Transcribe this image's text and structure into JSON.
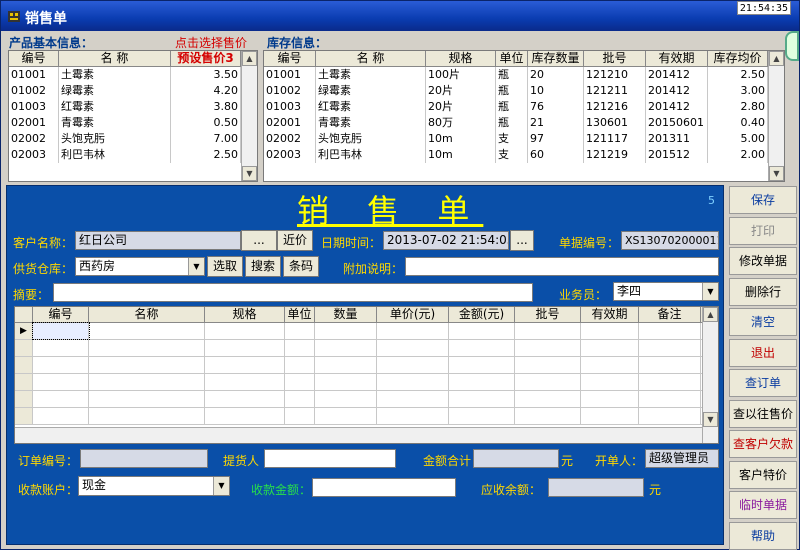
{
  "window": {
    "title": "销售单",
    "clock": "21:54:35"
  },
  "product_info": {
    "label": "产品基本信息：",
    "select_link": "点击选择售价",
    "columns": [
      "编号",
      "名 称",
      "预设售价3"
    ],
    "rows": [
      [
        "01001",
        "土霉素",
        "3.50"
      ],
      [
        "01002",
        "绿霉素",
        "4.20"
      ],
      [
        "01003",
        "红霉素",
        "3.80"
      ],
      [
        "02001",
        "青霉素",
        "0.50"
      ],
      [
        "02002",
        "头饱克肟",
        "7.00"
      ],
      [
        "02003",
        "利巴韦林",
        "2.50"
      ]
    ]
  },
  "stock_info": {
    "label": "库存信息：",
    "columns": [
      "编号",
      "名 称",
      "规格",
      "单位",
      "库存数量",
      "批号",
      "有效期",
      "库存均价"
    ],
    "rows": [
      [
        "01001",
        "土霉素",
        "100片",
        "瓶",
        "20",
        "121210",
        "201412",
        "2.50"
      ],
      [
        "01002",
        "绿霉素",
        "20片",
        "瓶",
        "10",
        "121211",
        "201412",
        "3.00"
      ],
      [
        "01003",
        "红霉素",
        "20片",
        "瓶",
        "76",
        "121216",
        "201412",
        "2.80"
      ],
      [
        "02001",
        "青霉素",
        "80万",
        "瓶",
        "21",
        "130601",
        "20150601",
        "0.40"
      ],
      [
        "02002",
        "头饱克肟",
        "10m",
        "支",
        "97",
        "121117",
        "201311",
        "5.00"
      ],
      [
        "02003",
        "利巴韦林",
        "10m",
        "支",
        "60",
        "121219",
        "201512",
        "2.00"
      ]
    ]
  },
  "form": {
    "heading": "销 售 单",
    "corner_number": "5",
    "customer_label": "客户名称：",
    "customer_value": "红日公司",
    "ellipsis": "...",
    "recent_price": "近价",
    "date_label": "日期时间：",
    "date_value": "2013-07-02 21:54:05",
    "doc_no_label": "单据编号：",
    "doc_no_value": "XS130702000011",
    "warehouse_label": "供货仓库：",
    "warehouse_value": "西药房",
    "btn_select": "选取",
    "btn_search": "搜索",
    "btn_barcode": "条码",
    "extra_label": "附加说明：",
    "extra_value": "",
    "summary_label": "摘要：",
    "summary_value": "",
    "salesman_label": "业务员：",
    "salesman_value": "李四",
    "detail_columns": [
      "编号",
      "名称",
      "规格",
      "单位",
      "数量",
      "单价(元)",
      "金额(元)",
      "批号",
      "有效期",
      "备注"
    ],
    "order_no_label": "订单编号：",
    "order_no_value": "",
    "picker_label": "提货人",
    "picker_value": "",
    "total_label": "金额合计",
    "total_value": "",
    "yuan": "元",
    "opener_label": "开单人：",
    "opener_value": "超级管理员",
    "account_label": "收款账户：",
    "account_value": "现金",
    "received_label": "收款金额：",
    "received_value": "",
    "receivable_label": "应收余额：",
    "receivable_value": ""
  },
  "sidebar": {
    "buttons": [
      {
        "label": "保存",
        "style": "blue"
      },
      {
        "label": "打印",
        "style": "gray"
      },
      {
        "label": "修改单据",
        "style": "black"
      },
      {
        "label": "删除行",
        "style": "black"
      },
      {
        "label": "清空",
        "style": "blue"
      },
      {
        "label": "退出",
        "style": "red"
      },
      {
        "label": "查订单",
        "style": "blue"
      },
      {
        "label": "查以往售价",
        "style": "black"
      },
      {
        "label": "查客户欠款",
        "style": "red"
      },
      {
        "label": "客户特价",
        "style": "black"
      },
      {
        "label": "临时单据",
        "style": "purple"
      },
      {
        "label": "帮助",
        "style": "blue"
      }
    ]
  }
}
